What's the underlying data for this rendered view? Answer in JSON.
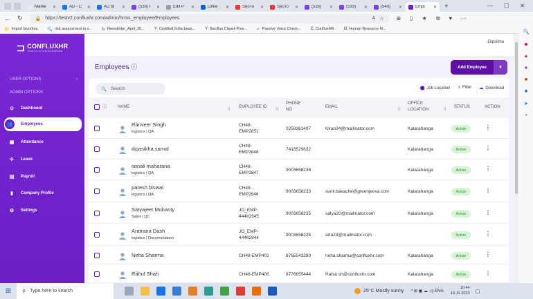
{
  "browser": {
    "tabs": [
      {
        "label": "Marke",
        "color": "#e8eaed",
        "active": false
      },
      {
        "label": "AD - C",
        "color": "#1a73e8",
        "active": false
      },
      {
        "label": "AD Bi",
        "color": "#1a73e8",
        "active": false
      },
      {
        "label": "(533) I",
        "color": "#7b3fe4",
        "active": false
      },
      {
        "label": "Edit P",
        "color": "#9e9e9e",
        "active": false
      },
      {
        "label": "Linke",
        "color": "#0a66c2",
        "active": false
      },
      {
        "label": "SeoTo",
        "color": "#e53935",
        "active": false
      },
      {
        "label": "SeoTo",
        "color": "#e53935",
        "active": false
      },
      {
        "label": "(533)",
        "color": "#7b3fe4",
        "active": false
      },
      {
        "label": "(533)",
        "color": "#7b3fe4",
        "active": false
      },
      {
        "label": "(540)",
        "color": "#7b3fe4",
        "active": false
      },
      {
        "label": "Empl",
        "color": "#6a1fc4",
        "active": true
      }
    ],
    "url": "https://testv2.confluxhr.com/admin/hrms_employee/Employees",
    "bookmarks": [
      {
        "label": "Import favorites",
        "icon": "📁"
      },
      {
        "label": "risk assessment in s...",
        "icon": "🔍"
      },
      {
        "label": "Newsletter_April_20...",
        "icon": "↻"
      },
      {
        "label": "Certified India-base...",
        "icon": "Y"
      },
      {
        "label": "Bacillus Clausii Pow...",
        "icon": "Y"
      },
      {
        "label": "Passive Voice Check...",
        "icon": "✓"
      },
      {
        "label": "ConfluxHR",
        "icon": "C"
      },
      {
        "label": "Human Resource M...",
        "icon": "O"
      }
    ]
  },
  "sidebar": {
    "logo_name": "CONFLUXHR",
    "logo_tagline": "YOUR ALL IN ONE HR PARTNER",
    "user_options": "USER OPTIONS",
    "admin_options": "ADMIN OPTIONS",
    "items": [
      {
        "label": "Dashboard",
        "icon": "⊙",
        "active": false
      },
      {
        "label": "Employees",
        "icon": "👥",
        "active": true
      },
      {
        "label": "Attendance",
        "icon": "▦",
        "active": false
      },
      {
        "label": "Leave",
        "icon": "✈",
        "active": false
      },
      {
        "label": "Payroll",
        "icon": "▤",
        "active": false
      },
      {
        "label": "Company Profile",
        "icon": "▮",
        "active": false
      },
      {
        "label": "Settings",
        "icon": "⚙",
        "active": false
      }
    ]
  },
  "header": {
    "profile": "Dipsikha"
  },
  "page": {
    "title": "Employees",
    "add_button": "Add Employee",
    "search_placeholder": "Search",
    "job_location": "Job Location",
    "filter": "Filter",
    "download": "Download"
  },
  "columns": {
    "name": "NAME",
    "employee_id": "EMPLOYEE ID",
    "phone_a": "PHONE",
    "phone_b": "NO",
    "email": "EMAIL",
    "office_a": "OFFICE",
    "office_b": "LOCATION",
    "status": "STATUS",
    "action": "ACTION"
  },
  "rows": [
    {
      "name": "Ranveer Singh",
      "dept": "logistics | QA",
      "id_a": "CH48-",
      "id_b": "EMP2851",
      "phone": "0258361497",
      "email": "Kiran34@mailinator.com",
      "office": "Kalarahanga",
      "status": "Active"
    },
    {
      "name": "dipasikha samal",
      "dept": "",
      "id_a": "CH48-",
      "id_b": "EMP2848",
      "phone": "7418529632",
      "email": "",
      "office": "Kalarahanga",
      "status": "Active"
    },
    {
      "name": "sonali maharana",
      "dept": "logistics | QA",
      "id_a": "CH48-",
      "id_b": "EMP2847",
      "phone": "9003658238",
      "email": "",
      "office": "Kalarahanga",
      "status": "Active"
    },
    {
      "name": "paresh biswal",
      "dept": "logistics | QA",
      "id_a": "CH48-",
      "id_b": "EMP2846",
      "phone": "9003658233",
      "email": "sunil.bavache@greenjeeva.com",
      "office": "Kalarahanga",
      "status": "Active"
    },
    {
      "name": "Satyajeet Mohanty",
      "dept": "Sales | QC",
      "id_a": "JO_EMP-",
      "id_b": "44482845",
      "phone": "9003658235",
      "email": "satya20@mailinator.com",
      "office": "Kalarahanga",
      "status": "Active"
    },
    {
      "name": "Aratrana Dash",
      "dept": "logistics | Documentation",
      "id_a": "JO_EMP-",
      "id_b": "44482844",
      "phone": "9003658225",
      "email": "arta23@mailinator.com",
      "office": "",
      "status": "Active"
    },
    {
      "name": "Neha Sharma",
      "dept": "",
      "id_a": "CH48-EMP402",
      "id_b": "",
      "phone": "8765543399",
      "email": "neha.sharma@confluxhr.com",
      "office": "Kalarahanga",
      "status": "Active"
    },
    {
      "name": "Rahul Shah",
      "dept": "",
      "id_a": "CH48-EMP406",
      "id_b": "",
      "phone": "8776655444",
      "email": "Rahul.sh@confluxhr.com",
      "office": "Kalarahanga",
      "status": "Active"
    }
  ],
  "taskbar": {
    "search_placeholder": "Type here to search",
    "weather": "25°C  Mostly sunny",
    "lang": "ENG",
    "time": "10:44",
    "date": "16-11-2023"
  },
  "colors": {
    "brand": "#6a1fc4",
    "brand_dark": "#5e0fa8",
    "active_badge_bg": "#d6f5d6",
    "active_badge_fg": "#2d8a2d"
  }
}
